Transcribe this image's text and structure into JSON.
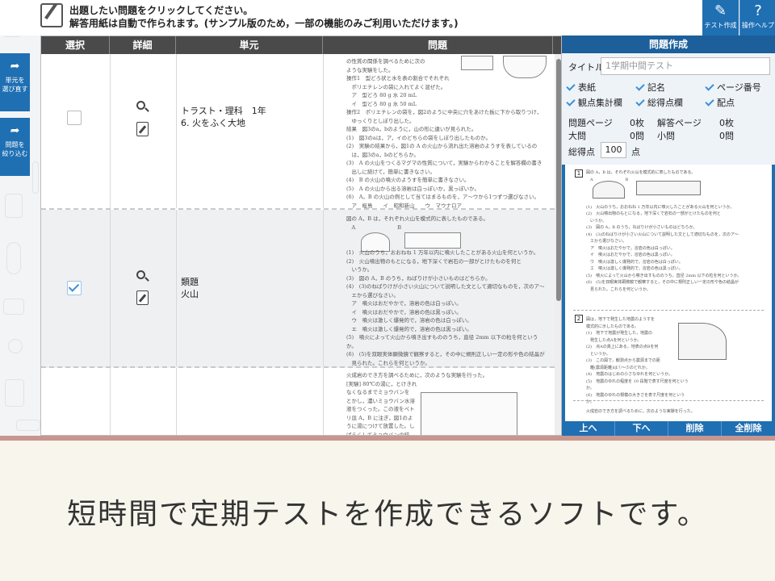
{
  "header": {
    "instruction_line1": "出題したい問題をクリックしてください。",
    "instruction_line2": "解答用紙は自動で作られます。(サンプル版のため，一部の機能のみご利用いただけます。)",
    "test_create_label": "テスト作成",
    "help_label": "操作ヘルプ"
  },
  "side_buttons": [
    {
      "label_line1": "単元を",
      "label_line2": "選び直す"
    },
    {
      "label_line1": "問題を",
      "label_line2": "絞り込む"
    }
  ],
  "table": {
    "headers": [
      "選択",
      "詳細",
      "単元",
      "問題"
    ],
    "rows": [
      {
        "selected": false,
        "unit_line1": "トラスト・理科　1年",
        "unit_line2": "6. 火をふく大地",
        "question_lines": [
          "の性質の関係を調べるために次の",
          "ような実験をした。",
          "操作1　型どろ状と水を表の割合でそれぞれ",
          "　ポリエチレンの袋に入れてよく混ぜた。",
          "　ア　型どろ 80 g  水 20 mL",
          "　イ　型どろ 80 g  水 50 mL",
          "操作2　ポリエチレンの袋を，図2のように中央に穴をあけた板に下から取りつけ，",
          "　ゆっくりとしぼり出した。",
          "結果　図3のa，bのように，山の形に違いが見られた。",
          "(1)　図3のaは，ア，イのどちらの袋をしぼり出したものか。",
          "(2)　実験の結果から，図1の A の火山から流れ出た溶岩のようすを表しているの",
          "　は，図3のa，bのどちらか。",
          "(3)　A の火山をつくるマグマの性質について，実験からわかることを解答欄の書き",
          "　出しに続けて，簡単に書きなさい。",
          "(4)　B の火山の噴火のようすを簡単に書きなさい。",
          "(5)　A の火山から出る溶岩は白っぽいか，黒っぽいか。",
          "(6)　A，B の火山の例として当てはまるものを，ア～ウから1つずつ選びなさい。",
          "　ア　桜島　　イ　昭和新山　　ウ　マウナロア"
        ]
      },
      {
        "selected": true,
        "unit_line1": "類題",
        "unit_line2": "火山",
        "question_lines": [
          "図の A，B は，それぞれ火山を模式的に表したものである。",
          "　A　　　　　　　　B",
          "",
          "",
          "(1)　火山のうち，おおねね 1 万年以内に噴火したことがある火山を何というか。",
          "(2)　火山噴出物のもとになる，地下深くで岩石の一部がとけたものを何と",
          "　いうか。",
          "(3)　図の A，B のうち，ねばりけが小さいものはどちらか。",
          "(4)　(3)のねばりけが小さい火山について説明した文として適切なものを，次のア～",
          "　エから選びなさい。",
          "　ア　噴火はおだやかで，溶岩の色は白っぽい。",
          "　イ　噴火はおだやかで，溶岩の色は黒っぽい。",
          "　ウ　噴火は激しく爆発的で，溶岩の色は白っぽい。",
          "　エ　噴火は激しく爆発的で，溶岩の色は黒っぽい。",
          "(5)　噴火によって火山から噴き出すもののうち，直径 2mm 以下の粒を何というか。",
          "(6)　(5)を双眼実体顕微鏡で観察すると，その中に規則正しい一定の形や色の結晶が",
          "　見られた。これらを何というか。"
        ]
      },
      {
        "selected": false,
        "unit_line1": "",
        "unit_line2": "",
        "question_lines": [
          "火成岩のでき方を調べるために，次のような実験を行った。",
          "[実験] 80℃の湯に，とけきれ",
          "なくなるまでミョウバンを",
          "とかし，濃いミョウバン水溶",
          "液をつくった。この液をペト",
          "リ皿 A，B に注ぎ，図1のよ",
          "うに湯につけて放置した。し",
          "ばらくしてミョウバンの結"
        ]
      }
    ]
  },
  "panel": {
    "title": "問題作成",
    "title_label": "タイトル",
    "title_placeholder": "1学期中間テスト",
    "options": [
      "表紙",
      "記名",
      "ページ番号",
      "観点集計欄",
      "総得点欄",
      "配点"
    ],
    "question_pages_label": "問題ページ",
    "question_pages_value": "0枚",
    "answer_pages_label": "解答ページ",
    "answer_pages_value": "0枚",
    "major_q_label": "大問",
    "major_q_value": "0問",
    "minor_q_label": "小問",
    "minor_q_value": "0問",
    "total_score_label": "総得点",
    "total_score_value": "100",
    "total_score_unit": "点",
    "preview_num1": "1",
    "preview_num2": "2",
    "preview_q1_lines": [
      "図の A，B は，それぞれ火山を模式的に表したものである。",
      "　A　　　　　　　　B",
      "",
      "",
      "",
      "(1)　火山のうち，おおねね 1 万年以内に噴火したことがある火山を何というか。",
      "(2)　火山噴出物のもとになる，地下深くで岩石の一部がとけたものを何と",
      "　いうか。",
      "(3)　図の A，B のうち，ねばりけが小さいものはどちらか。",
      "(4)　(3)のねばりけが小さい火山について説明した文として適切なものを，次のア～",
      "　エから選びなさい。",
      "　ア　噴火はおだやかで，溶岩の色は白っぽい。",
      "　イ　噴火はおだやかで，溶岩の色は黒っぽい。",
      "　ウ　噴火は激しく爆発的で，溶岩の色は白っぽい。",
      "　エ　噴火は激しく爆発的で，溶岩の色は黒っぽい。",
      "(5)　噴火によって火山から噴き出すもののうち，直径 2mm 以下の粒を何というか。",
      "(6)　(5)を双眼実体顕微鏡で観察すると，その中に規則正しい一定の形や色の結晶が",
      "　見られた。これらを何というか。"
    ],
    "preview_q2_lines": [
      "図は，地下で発生した地震のようすを",
      "模式的に示したものである。",
      "(1)　地下で地震が発生した，地震の",
      "　発生した点Aを何というか。",
      "(2)　点Aの真上にある，地表の点Bを何",
      "　というか。",
      "(3)　この図で，観測点から震源までの距",
      "　離(震源距離)は①～③のどれか。",
      "(4)　地震のはじめの小さなゆれを何というか。",
      "(5)　地震のゆれの程度を 10 段階で表す尺度を何というか。",
      "(6)　地震のゆれの規模の大きさを表す尺度を何というか。"
    ],
    "preview_q3_line": "火成岩のでき方を調べるために，次のような実験を行った。",
    "buttons": [
      "上へ",
      "下へ",
      "削除",
      "全削除"
    ]
  },
  "banner": {
    "caption": "短時間で定期テストを作成できるソフトです。"
  }
}
